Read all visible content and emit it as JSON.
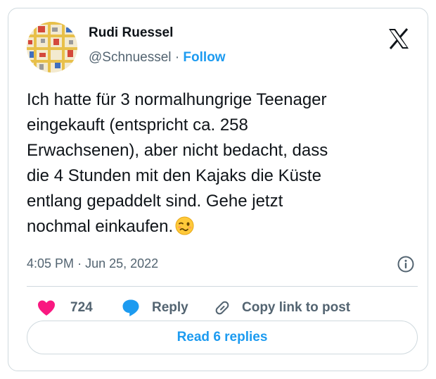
{
  "author": {
    "name": "Rudi Ruessel",
    "handle": "@Schnuessel",
    "separator": "·",
    "follow_label": "Follow"
  },
  "tweet": {
    "lines": [
      "Ich hatte für 3 normalhungrige Teenager",
      "eingekauft (entspricht ca. 258",
      "Erwachsenen), aber nicht bedacht, dass",
      "die 4 Stunden mit den Kajaks die Küste",
      "entlang gepaddelt sind. Gehe jetzt",
      "nochmal einkaufen."
    ],
    "emoji": "woozy-face"
  },
  "meta": {
    "time": "4:05 PM",
    "separator": "·",
    "date": "Jun 25, 2022"
  },
  "actions": {
    "like_count": "724",
    "reply_label": "Reply",
    "copy_label": "Copy link to post"
  },
  "read_replies_label": "Read 6 replies",
  "colors": {
    "accent": "#1d9bf0",
    "like": "#f91880",
    "text": "#0f1419",
    "muted": "#536471",
    "border": "#cfd9de"
  },
  "icons": [
    "x-logo-icon",
    "info-icon",
    "heart-icon",
    "reply-bubble-icon",
    "link-icon",
    "woozy-face-emoji"
  ]
}
